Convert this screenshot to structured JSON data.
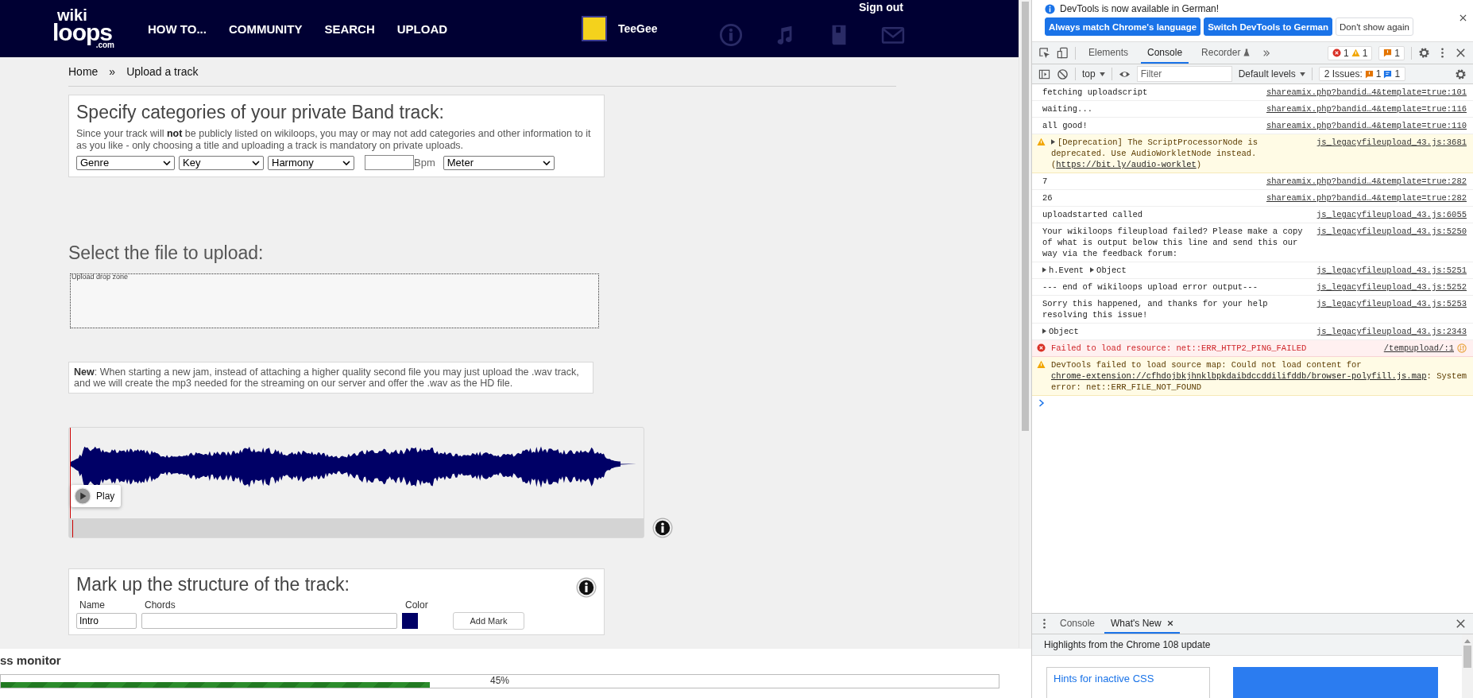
{
  "page": {
    "header": {
      "logo": {
        "top": "wiki",
        "main": "loops",
        "sub": ".com"
      },
      "nav": [
        {
          "label": "HOW TO..."
        },
        {
          "label": "COMMUNITY"
        },
        {
          "label": "SEARCH"
        },
        {
          "label": "UPLOAD"
        }
      ],
      "user": "TeeGee",
      "sign_out": "Sign out"
    },
    "breadcrumb": [
      {
        "label": "Home"
      },
      {
        "label": "»"
      },
      {
        "label": "Upload a track"
      }
    ],
    "categories": {
      "title": "Specify categories of your private Band track:",
      "description": "Since your track will **not** be publicly listed on wikiloops, you may or may not add categories and other information to it as you like - only choosing a title and uploading a track is mandatory on private uploads.",
      "fields": [
        {
          "kind": "select",
          "value": "Genre"
        },
        {
          "kind": "select",
          "value": "Key"
        },
        {
          "kind": "select",
          "value": "Harmony"
        },
        {
          "kind": "number",
          "unit": "Bpm"
        },
        {
          "kind": "select",
          "value": "Meter"
        }
      ]
    },
    "upload": {
      "title": "Select the file to upload:",
      "drop_zone_label": "Upload drop zone"
    },
    "notice": "**New**: When starting a new jam, instead of attaching a higher quality second file you may just upload the .wav track, and we will create the mp3 needed for the streaming on our server and offer the .wav as the HD file.",
    "player": {
      "play_label": "Play"
    },
    "structure": {
      "title": "Mark up the structure of the track:",
      "columns": [
        "Name",
        "Chords",
        "Color"
      ],
      "name_value": "Intro",
      "add_button": "Add Mark"
    },
    "monitor": {
      "title": "ss monitor",
      "level": 0.43,
      "reading": "45%"
    }
  },
  "devtools": {
    "banner": {
      "message": "DevTools is now available in German!",
      "buttons": [
        {
          "label": "Always match Chrome's language",
          "primary": true
        },
        {
          "label": "Switch DevTools to German",
          "primary": true
        },
        {
          "label": "Don't show again",
          "primary": false
        }
      ]
    },
    "tabs": [
      {
        "label": "Elements",
        "selected": false
      },
      {
        "label": "Console",
        "selected": true
      },
      {
        "label": "Recorder",
        "selected": false
      }
    ],
    "counts": {
      "errors": "1",
      "warnings": "1",
      "issues": "1"
    },
    "context": "top",
    "filter": {
      "placeholder": "Filter"
    },
    "levels": "Default levels",
    "issues": {
      "label": "2 Issues:",
      "warnings": "1",
      "info": "1"
    },
    "messages": [
      {
        "kind": "log",
        "segments": [
          {
            "kind": "text",
            "text": "fetching uploadscript"
          }
        ],
        "source": "shareamix.php?bandid…4&template=true:101"
      },
      {
        "kind": "log",
        "segments": [
          {
            "kind": "text",
            "text": "waiting..."
          }
        ],
        "source": "shareamix.php?bandid…4&template=true:116"
      },
      {
        "kind": "log",
        "segments": [
          {
            "kind": "text",
            "text": "all good!"
          }
        ],
        "source": "shareamix.php?bandid…4&template=true:110"
      },
      {
        "kind": "warning",
        "segments": [
          {
            "kind": "object",
            "text": "[Deprecation] The ScriptProcessorNode is deprecated. Use AudioWorkletNode instead. ("
          },
          {
            "kind": "link",
            "text": "https://bit.ly/audio-worklet"
          },
          {
            "kind": "text",
            "text": ")"
          }
        ],
        "source": "js_legacyfileupload_43.js:3681"
      },
      {
        "kind": "log",
        "segments": [
          {
            "kind": "text",
            "text": "7"
          }
        ],
        "source": "shareamix.php?bandid…4&template=true:282"
      },
      {
        "kind": "log",
        "segments": [
          {
            "kind": "text",
            "text": "26"
          }
        ],
        "source": "shareamix.php?bandid…4&template=true:282"
      },
      {
        "kind": "log",
        "segments": [
          {
            "kind": "text",
            "text": "uploadstarted called"
          }
        ],
        "source": "js_legacyfileupload_43.js:6055"
      },
      {
        "kind": "log",
        "segments": [
          {
            "kind": "text",
            "text": "Your wikiloops fileupload failed? Please make a copy of what is output below this line and send this our way via the feedback forum:"
          }
        ],
        "source": "js_legacyfileupload_43.js:5250"
      },
      {
        "kind": "log",
        "segments": [
          {
            "kind": "object",
            "text": "h.Event"
          },
          {
            "kind": "object",
            "text": "Object"
          }
        ],
        "source": "js_legacyfileupload_43.js:5251"
      },
      {
        "kind": "log",
        "segments": [
          {
            "kind": "text",
            "text": "--- end of wikiloops upload error output---"
          }
        ],
        "source": "js_legacyfileupload_43.js:5252"
      },
      {
        "kind": "log",
        "segments": [
          {
            "kind": "text",
            "text": "Sorry this happened, and thanks for your help resolving this issue!"
          }
        ],
        "source": "js_legacyfileupload_43.js:5253"
      },
      {
        "kind": "log",
        "segments": [
          {
            "kind": "object",
            "text": "Object"
          }
        ],
        "source": "js_legacyfileupload_43.js:2343"
      },
      {
        "kind": "error",
        "segments": [
          {
            "kind": "text",
            "text": "Failed to load resource: net::ERR_HTTP2_PING_FAILED"
          }
        ],
        "source": "/tempupload/:1"
      },
      {
        "kind": "warning",
        "segments": [
          {
            "kind": "text",
            "text": "DevTools failed to load source map: Could not load content for "
          },
          {
            "kind": "link",
            "text": "chrome-extension://cfhdojbkjhnklbpkdaibdccddilifddb/browser-polyfill.js.map"
          },
          {
            "kind": "text",
            "text": ": System error: net::ERR_FILE_NOT_FOUND"
          }
        ]
      }
    ],
    "drawer": {
      "tabs": [
        {
          "label": "Console",
          "selected": false,
          "closable": false
        },
        {
          "label": "What's New",
          "selected": true,
          "closable": true
        }
      ],
      "heading": "Highlights from the Chrome 108 update",
      "card": "Hints for inactive CSS"
    }
  }
}
